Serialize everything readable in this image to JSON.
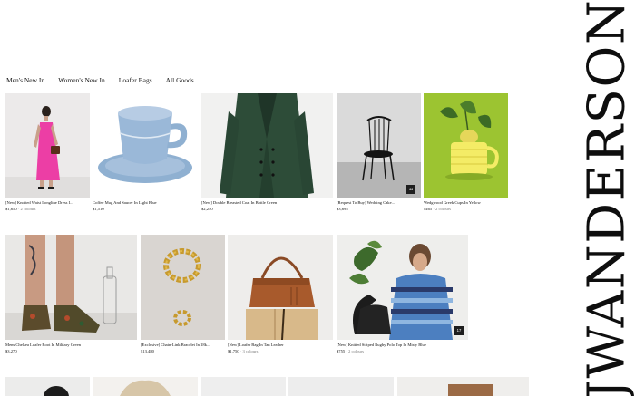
{
  "brand": {
    "logo_text": "JWANDERSON"
  },
  "nav": {
    "items": [
      {
        "label": "Men's New In"
      },
      {
        "label": "Women's New In"
      },
      {
        "label": "Loafer Bags"
      },
      {
        "label": "All Goods"
      }
    ]
  },
  "products": [
    {
      "title": "[New] Knotted Waist Longline Dress I...",
      "price": "$1,650",
      "colours": "· 2 colours"
    },
    {
      "title": "Coffee Mug And Saucer In Light Blue",
      "price": "$1,510",
      "colours": ""
    },
    {
      "title": "[New] Double Breasted Coat In Bottle Green",
      "price": "$2,250",
      "colours": ""
    },
    {
      "title": "[Request To Buy] Wedding Cake...",
      "price": "$3,695",
      "colours": "",
      "badge": "11"
    },
    {
      "title": "Wedgwood Greek Cups In Yellow",
      "price": "$465",
      "colours": "· 2 colours"
    },
    {
      "title": "Mens Chelsea Loafer Boot In Military Green",
      "price": "$3,270",
      "colours": ""
    },
    {
      "title": "[Exclusive] Chain-Link Bracelet In 18k...",
      "price": "$13,480",
      "colours": ""
    },
    {
      "title": "[New] Loafer Bag In Tan Leather",
      "price": "$1,750",
      "colours": "· 3 colours"
    },
    {
      "title": "[New] Knitted Striped Rugby Polo Top In Misty Blue",
      "price": "$755",
      "colours": "· 2 colours",
      "badge": "17"
    }
  ],
  "colors": {
    "accent_green": "#9cc431",
    "background": "#ffffff",
    "badge": "#1e1e1e"
  }
}
